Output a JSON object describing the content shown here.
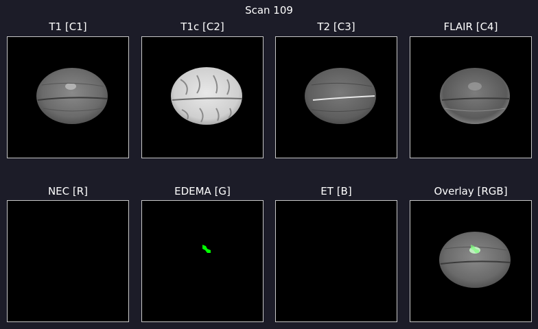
{
  "figure": {
    "title": "Scan 109"
  },
  "panels": [
    {
      "title": "T1 [C1]"
    },
    {
      "title": "T1c [C2]"
    },
    {
      "title": "T2 [C3]"
    },
    {
      "title": "FLAIR [C4]"
    },
    {
      "title": "NEC [R]"
    },
    {
      "title": "EDEMA [G]"
    },
    {
      "title": "ET [B]"
    },
    {
      "title": "Overlay [RGB]"
    }
  ],
  "colors": {
    "background": "#1c1c28",
    "edema_mask": "#00ff00",
    "panel_border": "#c8c8c8"
  }
}
